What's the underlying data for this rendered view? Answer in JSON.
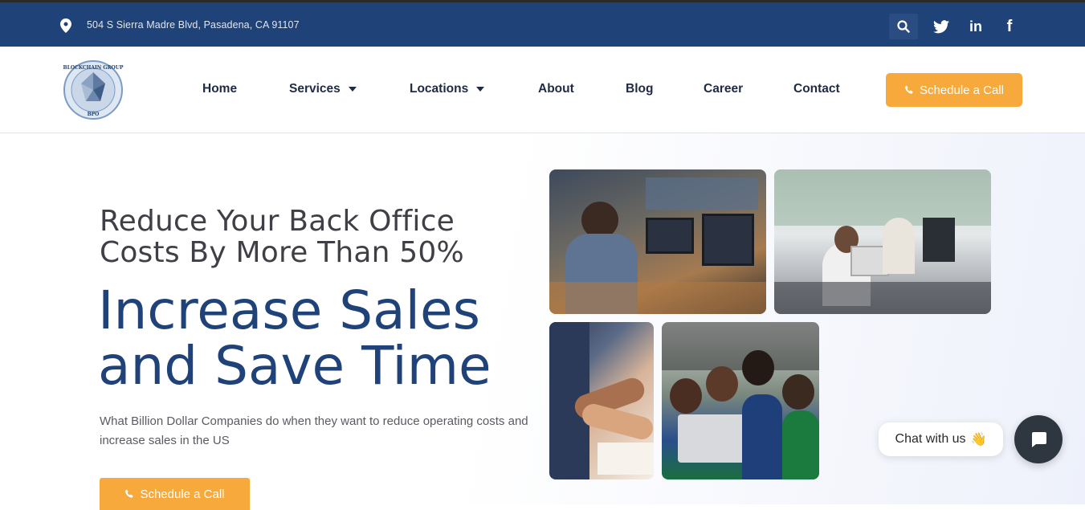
{
  "topbar": {
    "address": "504 S Sierra Madre Blvd, Pasadena, CA 91107",
    "icons": [
      "location-pin-icon",
      "search-icon",
      "twitter-icon",
      "linkedin-icon",
      "facebook-icon"
    ],
    "linkedin_label": "in",
    "facebook_label": "f"
  },
  "logo": {
    "text_top": "BLOCKCHAIN GROUP",
    "text_bottom": "BPO"
  },
  "nav": {
    "items": [
      {
        "label": "Home"
      },
      {
        "label": "Services"
      },
      {
        "label": "Locations"
      },
      {
        "label": "About"
      },
      {
        "label": "Blog"
      },
      {
        "label": "Career"
      },
      {
        "label": "Contact"
      }
    ],
    "cta_label": "Schedule a Call"
  },
  "hero": {
    "sub_heading": "Reduce Your Back Office Costs By More Than 50%",
    "heading": "Increase Sales and Save Time",
    "description": "What Billion Dollar Companies do when they want to reduce operating costs and increase sales in the US",
    "cta_label": "Schedule a Call"
  },
  "chat": {
    "bubble_text": "Chat with us",
    "bubble_emoji": "👋"
  },
  "colors": {
    "primary": "#1f4379",
    "accent": "#f7a93b",
    "chat_button": "#2e3640"
  }
}
